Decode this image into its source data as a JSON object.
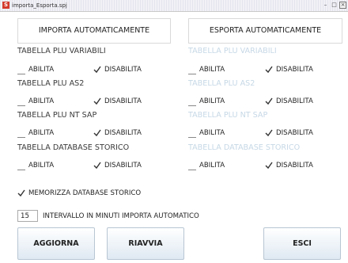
{
  "window": {
    "title": "importa_Esporta.spj",
    "app_icon": "S",
    "controls": [
      "minimize-icon",
      "maximize-icon",
      "close-icon"
    ]
  },
  "header": {
    "import_label": "IMPORTA AUTOMATICAMENTE",
    "export_label": "ESPORTA AUTOMATICAMENTE"
  },
  "options": {
    "enable_label": "ABILITA",
    "disable_label": "DISABILITA"
  },
  "sections": [
    {
      "left_label": "TABELLA PLU VARIABILI",
      "right_label": "TABELLA PLU VARIABILI"
    },
    {
      "left_label": "TABELLA PLU AS2",
      "right_label": "TABELLA PLU AS2"
    },
    {
      "left_label": "TABELLA PLU NT SAP",
      "right_label": "TABELLA PLU NT SAP"
    },
    {
      "left_label": "TABELLA DATABASE STORICO",
      "right_label": "TABELLA DATABASE STORICO"
    }
  ],
  "footer": {
    "memorize_label": "MEMORIZZA DATABASE STORICO",
    "memorize_checked": true,
    "interval_value": "15",
    "interval_label": "INTERVALLO IN MINUTI IMPORTA AUTOMATICO",
    "refresh_label": "AGGIORNA",
    "restart_label": "RIAVVIA",
    "exit_label": "ESCI"
  },
  "colors": {
    "disabled_text": "#c6d8e6",
    "button_gradient_bottom": "#dfe9f2"
  }
}
